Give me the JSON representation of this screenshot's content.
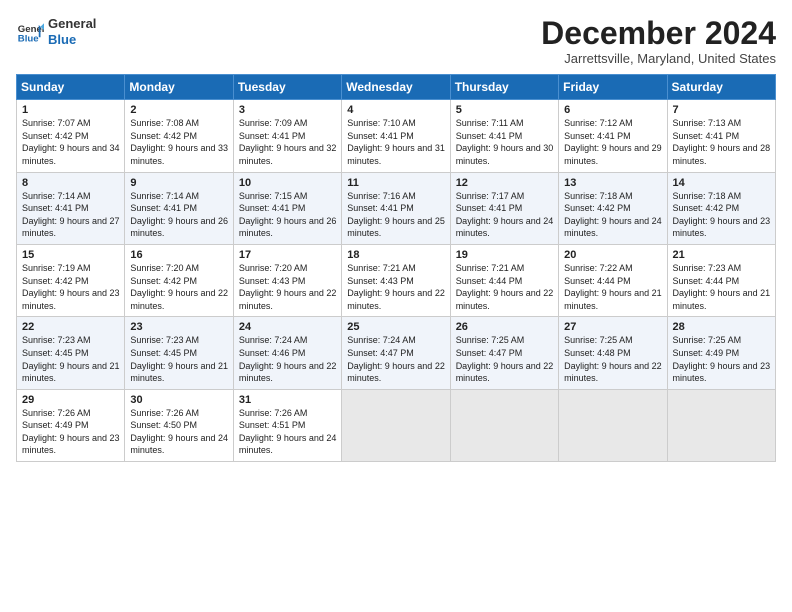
{
  "header": {
    "logo_line1": "General",
    "logo_line2": "Blue",
    "month_title": "December 2024",
    "location": "Jarrettsville, Maryland, United States"
  },
  "days_of_week": [
    "Sunday",
    "Monday",
    "Tuesday",
    "Wednesday",
    "Thursday",
    "Friday",
    "Saturday"
  ],
  "weeks": [
    [
      {
        "day": "1",
        "sunrise": "Sunrise: 7:07 AM",
        "sunset": "Sunset: 4:42 PM",
        "daylight": "Daylight: 9 hours and 34 minutes."
      },
      {
        "day": "2",
        "sunrise": "Sunrise: 7:08 AM",
        "sunset": "Sunset: 4:42 PM",
        "daylight": "Daylight: 9 hours and 33 minutes."
      },
      {
        "day": "3",
        "sunrise": "Sunrise: 7:09 AM",
        "sunset": "Sunset: 4:41 PM",
        "daylight": "Daylight: 9 hours and 32 minutes."
      },
      {
        "day": "4",
        "sunrise": "Sunrise: 7:10 AM",
        "sunset": "Sunset: 4:41 PM",
        "daylight": "Daylight: 9 hours and 31 minutes."
      },
      {
        "day": "5",
        "sunrise": "Sunrise: 7:11 AM",
        "sunset": "Sunset: 4:41 PM",
        "daylight": "Daylight: 9 hours and 30 minutes."
      },
      {
        "day": "6",
        "sunrise": "Sunrise: 7:12 AM",
        "sunset": "Sunset: 4:41 PM",
        "daylight": "Daylight: 9 hours and 29 minutes."
      },
      {
        "day": "7",
        "sunrise": "Sunrise: 7:13 AM",
        "sunset": "Sunset: 4:41 PM",
        "daylight": "Daylight: 9 hours and 28 minutes."
      }
    ],
    [
      {
        "day": "8",
        "sunrise": "Sunrise: 7:14 AM",
        "sunset": "Sunset: 4:41 PM",
        "daylight": "Daylight: 9 hours and 27 minutes."
      },
      {
        "day": "9",
        "sunrise": "Sunrise: 7:14 AM",
        "sunset": "Sunset: 4:41 PM",
        "daylight": "Daylight: 9 hours and 26 minutes."
      },
      {
        "day": "10",
        "sunrise": "Sunrise: 7:15 AM",
        "sunset": "Sunset: 4:41 PM",
        "daylight": "Daylight: 9 hours and 26 minutes."
      },
      {
        "day": "11",
        "sunrise": "Sunrise: 7:16 AM",
        "sunset": "Sunset: 4:41 PM",
        "daylight": "Daylight: 9 hours and 25 minutes."
      },
      {
        "day": "12",
        "sunrise": "Sunrise: 7:17 AM",
        "sunset": "Sunset: 4:41 PM",
        "daylight": "Daylight: 9 hours and 24 minutes."
      },
      {
        "day": "13",
        "sunrise": "Sunrise: 7:18 AM",
        "sunset": "Sunset: 4:42 PM",
        "daylight": "Daylight: 9 hours and 24 minutes."
      },
      {
        "day": "14",
        "sunrise": "Sunrise: 7:18 AM",
        "sunset": "Sunset: 4:42 PM",
        "daylight": "Daylight: 9 hours and 23 minutes."
      }
    ],
    [
      {
        "day": "15",
        "sunrise": "Sunrise: 7:19 AM",
        "sunset": "Sunset: 4:42 PM",
        "daylight": "Daylight: 9 hours and 23 minutes."
      },
      {
        "day": "16",
        "sunrise": "Sunrise: 7:20 AM",
        "sunset": "Sunset: 4:42 PM",
        "daylight": "Daylight: 9 hours and 22 minutes."
      },
      {
        "day": "17",
        "sunrise": "Sunrise: 7:20 AM",
        "sunset": "Sunset: 4:43 PM",
        "daylight": "Daylight: 9 hours and 22 minutes."
      },
      {
        "day": "18",
        "sunrise": "Sunrise: 7:21 AM",
        "sunset": "Sunset: 4:43 PM",
        "daylight": "Daylight: 9 hours and 22 minutes."
      },
      {
        "day": "19",
        "sunrise": "Sunrise: 7:21 AM",
        "sunset": "Sunset: 4:44 PM",
        "daylight": "Daylight: 9 hours and 22 minutes."
      },
      {
        "day": "20",
        "sunrise": "Sunrise: 7:22 AM",
        "sunset": "Sunset: 4:44 PM",
        "daylight": "Daylight: 9 hours and 21 minutes."
      },
      {
        "day": "21",
        "sunrise": "Sunrise: 7:23 AM",
        "sunset": "Sunset: 4:44 PM",
        "daylight": "Daylight: 9 hours and 21 minutes."
      }
    ],
    [
      {
        "day": "22",
        "sunrise": "Sunrise: 7:23 AM",
        "sunset": "Sunset: 4:45 PM",
        "daylight": "Daylight: 9 hours and 21 minutes."
      },
      {
        "day": "23",
        "sunrise": "Sunrise: 7:23 AM",
        "sunset": "Sunset: 4:45 PM",
        "daylight": "Daylight: 9 hours and 21 minutes."
      },
      {
        "day": "24",
        "sunrise": "Sunrise: 7:24 AM",
        "sunset": "Sunset: 4:46 PM",
        "daylight": "Daylight: 9 hours and 22 minutes."
      },
      {
        "day": "25",
        "sunrise": "Sunrise: 7:24 AM",
        "sunset": "Sunset: 4:47 PM",
        "daylight": "Daylight: 9 hours and 22 minutes."
      },
      {
        "day": "26",
        "sunrise": "Sunrise: 7:25 AM",
        "sunset": "Sunset: 4:47 PM",
        "daylight": "Daylight: 9 hours and 22 minutes."
      },
      {
        "day": "27",
        "sunrise": "Sunrise: 7:25 AM",
        "sunset": "Sunset: 4:48 PM",
        "daylight": "Daylight: 9 hours and 22 minutes."
      },
      {
        "day": "28",
        "sunrise": "Sunrise: 7:25 AM",
        "sunset": "Sunset: 4:49 PM",
        "daylight": "Daylight: 9 hours and 23 minutes."
      }
    ],
    [
      {
        "day": "29",
        "sunrise": "Sunrise: 7:26 AM",
        "sunset": "Sunset: 4:49 PM",
        "daylight": "Daylight: 9 hours and 23 minutes."
      },
      {
        "day": "30",
        "sunrise": "Sunrise: 7:26 AM",
        "sunset": "Sunset: 4:50 PM",
        "daylight": "Daylight: 9 hours and 24 minutes."
      },
      {
        "day": "31",
        "sunrise": "Sunrise: 7:26 AM",
        "sunset": "Sunset: 4:51 PM",
        "daylight": "Daylight: 9 hours and 24 minutes."
      },
      null,
      null,
      null,
      null
    ]
  ]
}
